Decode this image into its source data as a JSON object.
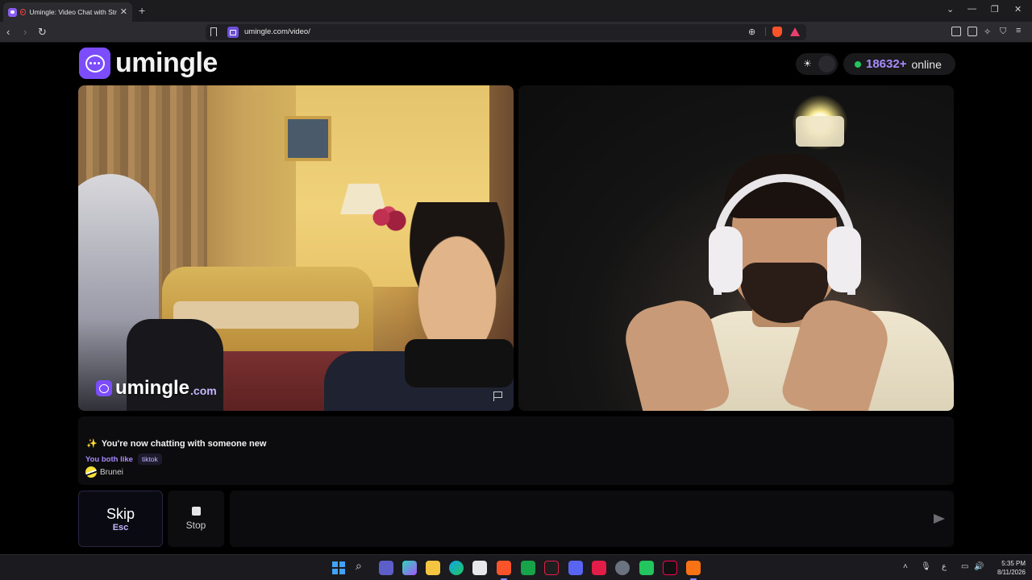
{
  "browser": {
    "tab_title": "Umingle: Video Chat with Stra",
    "url": "umingle.com/video/"
  },
  "site": {
    "logo_text": "umingle",
    "online_count": "18632+",
    "online_label": "online"
  },
  "video": {
    "watermark_text": "umingle",
    "watermark_suffix": ".com"
  },
  "chat": {
    "system_message": "You're now chatting with someone new",
    "interests_label": "You both like",
    "interest_tag": "tiktok",
    "location": "Brunei"
  },
  "controls": {
    "skip_label": "Skip",
    "skip_key": "Esc",
    "stop_label": "Stop",
    "message_placeholder": ""
  },
  "taskbar": {
    "time": "5:35 PM",
    "date": "8/11/2026"
  },
  "colors": {
    "brand": "#7c4dff",
    "online": "#22c55e",
    "accent_text": "#a78bfa"
  }
}
